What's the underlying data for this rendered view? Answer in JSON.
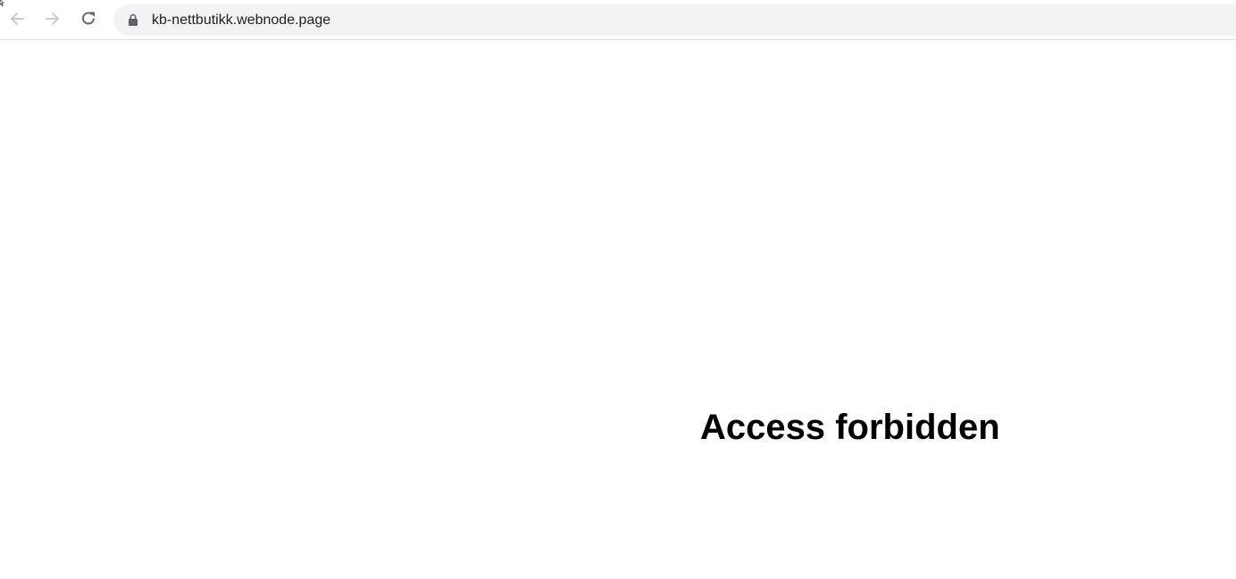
{
  "browser": {
    "url": "kb-nettbutikk.webnode.page",
    "icons": {
      "back": "arrow-left-icon",
      "forward": "arrow-right-icon",
      "reload": "reload-icon",
      "security": "lock-icon"
    }
  },
  "page": {
    "heading": "Access forbidden"
  }
}
